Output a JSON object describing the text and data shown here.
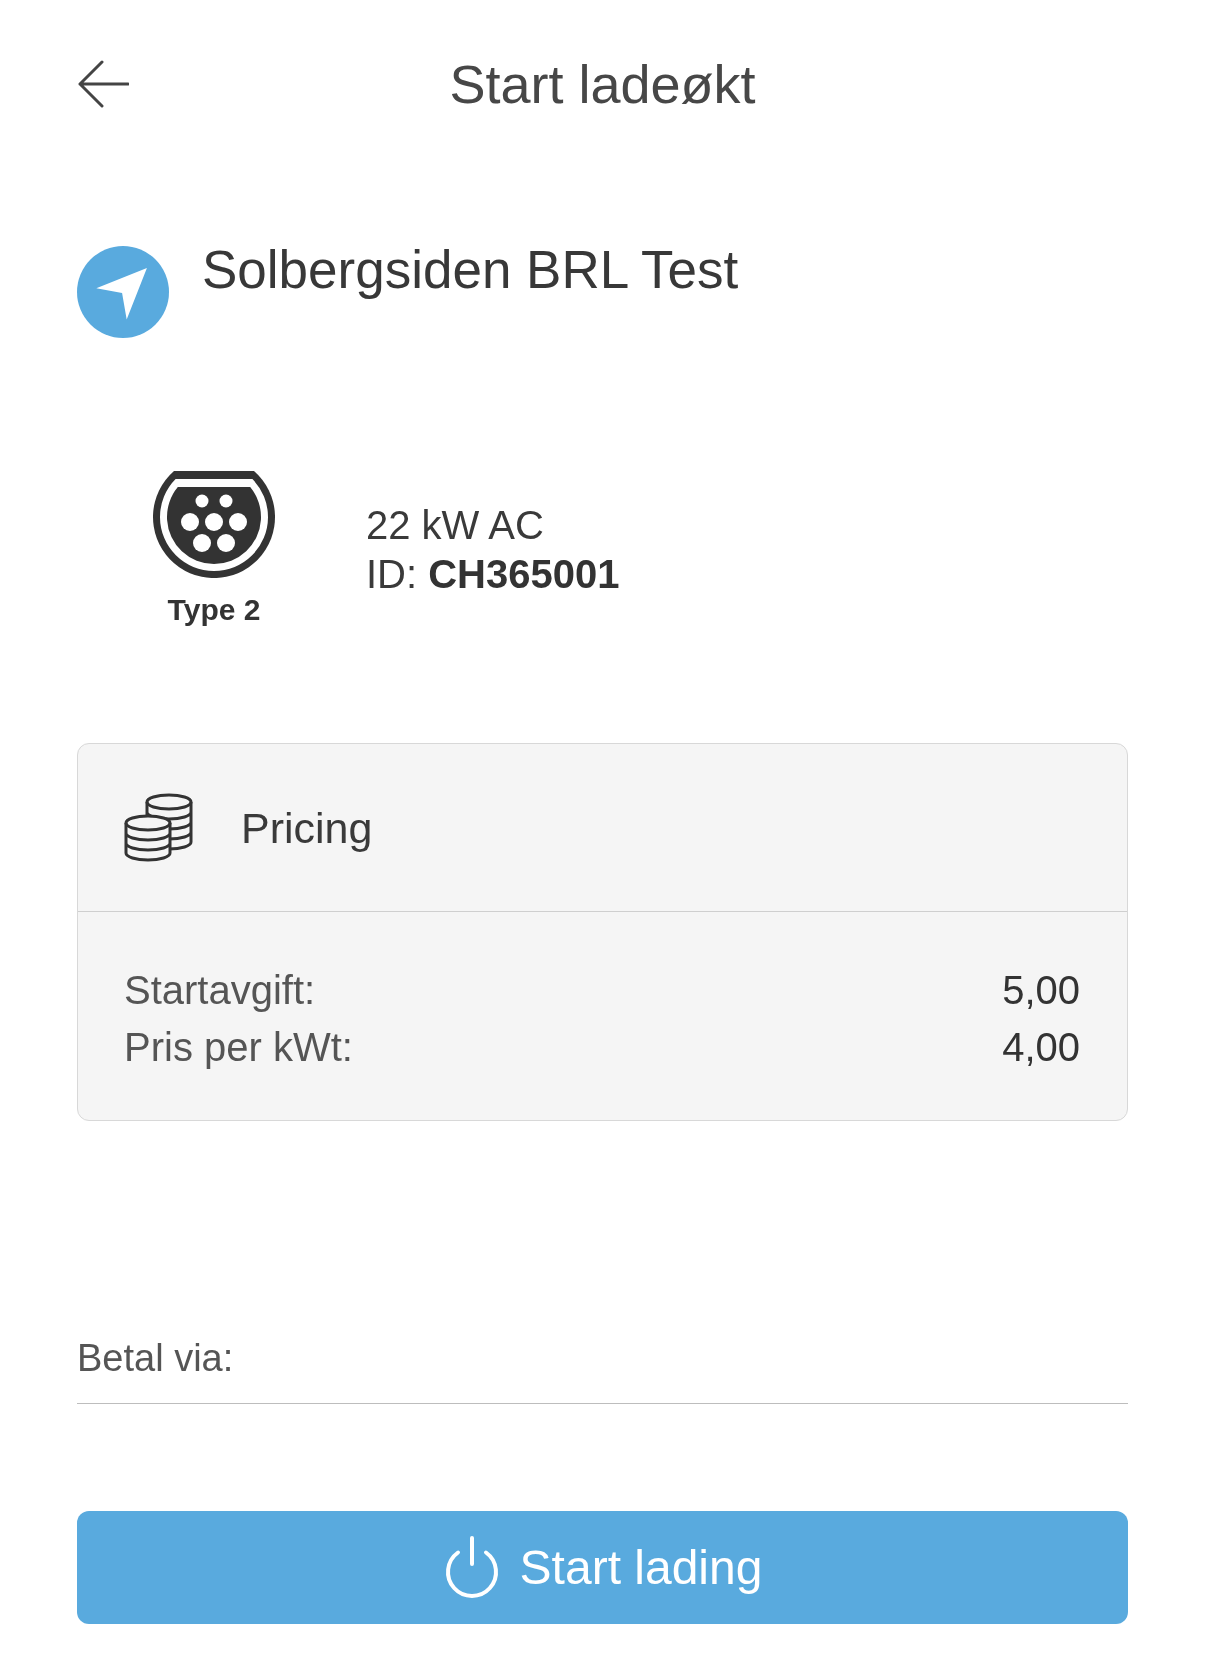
{
  "header": {
    "title": "Start ladeøkt"
  },
  "station": {
    "name": "Solbergsiden BRL Test"
  },
  "connector": {
    "type": "Type 2",
    "power": "22 kW AC",
    "id_line": "ID: **CH365001**"
  },
  "pricing": {
    "title": "Pricing",
    "rows": [
      {
        "label": "Startavgift:",
        "value": "5,00"
      },
      {
        "label": "Pris per kWt:",
        "value": "4,00"
      }
    ]
  },
  "payment": {
    "label": "Betal via:"
  },
  "start_button": {
    "label": "Start lading"
  }
}
